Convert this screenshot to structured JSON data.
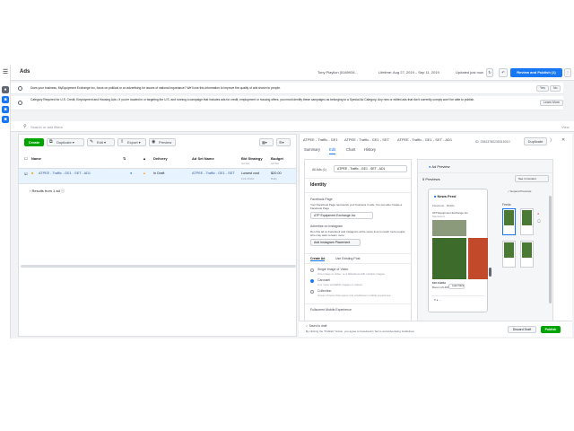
{
  "app": {
    "title": "Ads"
  },
  "header": {
    "account": "Tony Playlion (5169934...",
    "date_range": "Lifetime: Aug 27, 2019 – Sep 11, 2019",
    "updated": "Updated just now",
    "review_publish": "Review and Publish (1)"
  },
  "notices": [
    {
      "text": "Does your business, MyEquipment Exchange Inc, focus on political or on advertising for issues of national importance? We'll use this information to improve the quality of ads shown to people.",
      "yes": "Yes",
      "no": "No"
    },
    {
      "text": "Category Required for U.S. Credit, Employment and Housing Ads • If you're located in or targeting the U.S. and running a campaign that includes ads for credit, employment or housing offers, you must identify these campaigns as belonging to a Special Ad Category. Any new or edited ads that don't currently comply won't be able to publish.",
      "learn_more": "Learn More"
    }
  ],
  "search": {
    "placeholder": "Search or add filters",
    "view": "View"
  },
  "toolbar": {
    "create": "Create",
    "duplicate": "Duplicate",
    "edit": "Edit",
    "export": "Export",
    "preview": "Preview"
  },
  "table": {
    "headers": {
      "name": "Name",
      "delivery": "Delivery",
      "ad_set_name": "Ad Set Name",
      "bid_strategy": "Bid Strategy",
      "bid_strategy_sub": "Ad Set",
      "budget": "Budget",
      "budget_sub": "Ad Set"
    },
    "rows": [
      {
        "name": "ATPEE - Traffic - GE1 - SET - AD1",
        "delivery": "In Draft",
        "ad_set_name": "ATPEE - Traffic - GE1 - SET",
        "bid_strategy": "Lowest cost",
        "bid_strategy_sub": "Link Clicks",
        "budget": "$20.00",
        "budget_sub": "Daily"
      }
    ],
    "results": "Results from 1 ad"
  },
  "editor": {
    "breadcrumb": [
      "ATPEE - Traffic - GE1",
      "ATPEE - Traffic - GE1 - SET",
      "ATPEE - Traffic - GE1 - SET - AD1"
    ],
    "id_label": "ID: 23843780235315010",
    "duplicate": "Duplicate",
    "tabs": [
      "Summary",
      "Edit",
      "Chart",
      "History"
    ],
    "all_ads_label": "All Ads (1)",
    "ad_name_value": "ATPEE - Traffic - GE1 - SET - AD1",
    "identity_title": "Identity",
    "facebook_page_label": "Facebook Page",
    "facebook_page_help": "Your Facebook Page represents your business in ads. You can also Create a Facebook Page",
    "facebook_page_value": "ATP Equipment Exchange Inc",
    "instagram_label": "Advertise on Instagram",
    "instagram_help": "Run this ad on Facebook and Instagram at the same time to reach more people who may want to learn more.",
    "instagram_button": "Add Instagram Placement",
    "create_ad_tab": "Create Ad",
    "use_existing_tab": "Use Existing Post",
    "formats": [
      {
        "title": "Single Image or Video",
        "desc": "One image or video, or a slideshow with multiple images"
      },
      {
        "title": "Carousel",
        "desc": "2 or more scrollable images or videos"
      },
      {
        "title": "Collection",
        "desc": "Group of items that opens into a fullscreen mobile experience"
      }
    ],
    "fullscreen_label": "Fullscreen Mobile Experience"
  },
  "preview": {
    "toggle_label": "Ad Preview",
    "count": "5 Previews",
    "see_in_context": "See in Context",
    "expand": "Expand Previews",
    "feeds_label": "Feeds",
    "phone_header": "News Feed",
    "phone_sub": "Facebook · Mobile",
    "page_name": "ATP Equipment Exchange Inc",
    "sponsored": "Sponsored",
    "card_price": "$16.6 BRH",
    "card_sub": "Boom Lift 40ft",
    "card_cta": "Learn More"
  },
  "footer": {
    "saved": "Saved to draft",
    "terms": "By clicking the \"Publish\" button, you agree to Facebook's Terms and Advertising Guidelines",
    "discard": "Discard Draft",
    "publish": "Publish"
  },
  "colors": {
    "brand": "#1877f2",
    "create_green": "#00a400",
    "row_select": "#e7f3ff"
  }
}
